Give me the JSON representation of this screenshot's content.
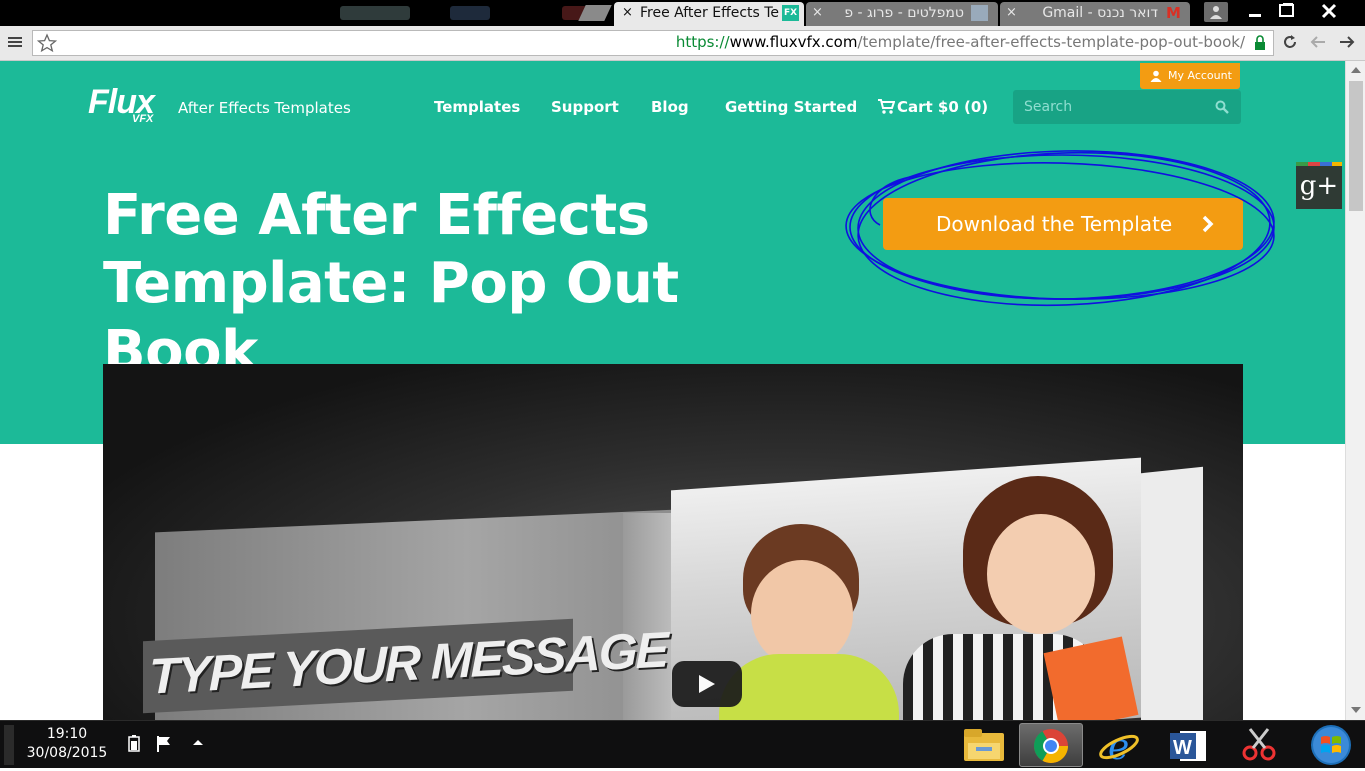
{
  "browser": {
    "tabs": [
      {
        "title": "Free After Effects Te",
        "favicon": "FX",
        "active": true
      },
      {
        "title": "טמפלטים - פרוג - פ",
        "favicon": "photo-icon",
        "active": false
      },
      {
        "title": "דואר נכנס - Gmail",
        "favicon": "M",
        "active": false
      }
    ],
    "close_glyph": "×",
    "url": {
      "scheme": "https://",
      "host": "www.fluxvfx.com",
      "path": "/template/free-after-effects-template-pop-out-book/"
    },
    "window_controls": [
      "minimize",
      "maximize",
      "close"
    ]
  },
  "site": {
    "logo": "Flux",
    "logo_sub": "VFX",
    "tagline": "After Effects Templates",
    "nav": [
      "Templates",
      "Support",
      "Blog",
      "Getting Started"
    ],
    "cart": "Cart $0 (0)",
    "my_account": "My Account",
    "search_placeholder": "Search",
    "headline": "Free After Effects Template: Pop Out Book",
    "download_button": "Download the Template",
    "gplus": "g+",
    "video": {
      "overlay_text": "TYPE YOUR MESSAGE",
      "play_button": "play"
    }
  },
  "colors": {
    "hero": "#1cba98",
    "accent": "#f39c12",
    "annotation": "#1010e0"
  },
  "taskbar": {
    "time": "19:10",
    "date": "30/08/2015",
    "apps": [
      "file-explorer",
      "chrome",
      "internet-explorer",
      "word",
      "snipping-tool",
      "start"
    ]
  }
}
